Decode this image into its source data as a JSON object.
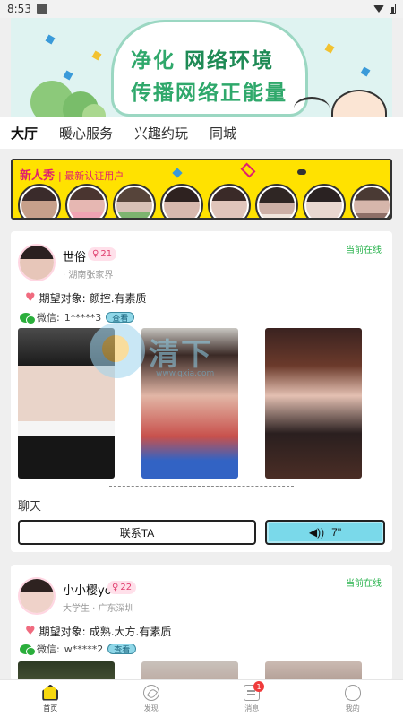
{
  "status_bar": {
    "time": "8:53"
  },
  "banner": {
    "line1_a": "净化",
    "line1_b": "网络环境",
    "line2": "传播网络正能量"
  },
  "tabs": [
    {
      "label": "大厅",
      "active": true
    },
    {
      "label": "暖心服务"
    },
    {
      "label": "兴趣约玩"
    },
    {
      "label": "同城"
    }
  ],
  "new_users": {
    "title": "新人秀",
    "subtitle": "| 最新认证用户",
    "avatar_count_colors": [
      "#c7a08b",
      "#d9b3a3",
      "#9c8b83",
      "#d8b9ae",
      "#e0c5bb",
      "#cdb0a6",
      "#b8a39a",
      "#d6b6ab"
    ]
  },
  "posts": [
    {
      "name": "世俗",
      "age": "21",
      "location": "· 湖南张家界",
      "online": "当前在线",
      "expect_label": "期望对象:",
      "expect_value": "颜控.有素质",
      "wechat_label": "微信:",
      "wechat_value": "1*****3",
      "view": "查看",
      "chat_label": "聊天",
      "contact": "联系TA",
      "voice": "7\""
    },
    {
      "name": "小小樱yo",
      "age": "22",
      "location": "大学生 · 广东深圳",
      "online": "当前在线",
      "expect_label": "期望对象:",
      "expect_value": "成熟.大方.有素质",
      "wechat_label": "微信:",
      "wechat_value": "w*****2",
      "view": "查看"
    }
  ],
  "watermark": {
    "text": "清下",
    "url": "www.qxia.com"
  },
  "bottom_nav": [
    {
      "label": "首页",
      "active": true
    },
    {
      "label": "发现"
    },
    {
      "label": "消息",
      "badge": "1"
    },
    {
      "label": "我的"
    }
  ]
}
